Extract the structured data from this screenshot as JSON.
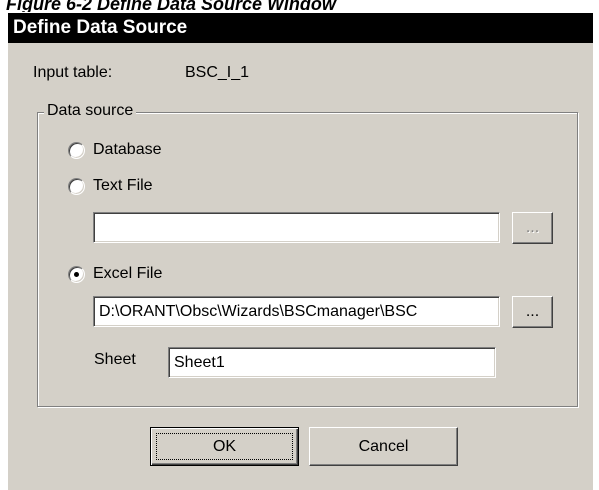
{
  "figure_caption": "Figure 6-2   Define Data Source Window",
  "window": {
    "title": "Define Data Source"
  },
  "input_table": {
    "label": "Input table:",
    "value": "BSC_I_1"
  },
  "data_source": {
    "group_label": "Data source",
    "options": [
      {
        "label": "Database",
        "selected": false
      },
      {
        "label": "Text File",
        "selected": false
      },
      {
        "label": "Excel File",
        "selected": true
      }
    ],
    "text_file_path": "",
    "excel_file_path": "D:\\ORANT\\Obsc\\Wizards\\BSCmanager\\BSC",
    "browse_label": "...",
    "sheet_label": "Sheet",
    "sheet_value": "Sheet1"
  },
  "buttons": {
    "ok": "OK",
    "cancel": "Cancel"
  }
}
